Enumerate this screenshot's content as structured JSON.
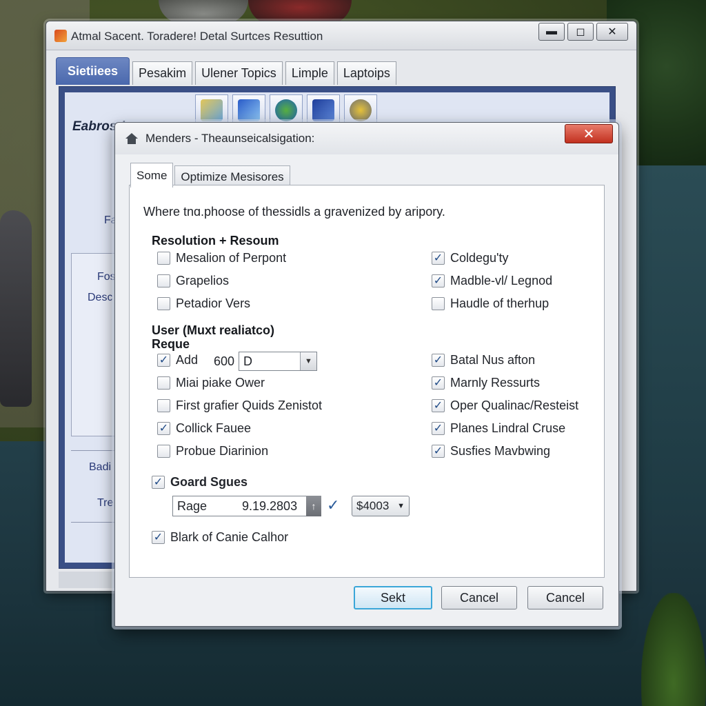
{
  "back_window": {
    "title": "Atmal Sacent. Toradere! Detal Surtces Resuttion",
    "tabs": [
      "Sietiiees",
      "Pesakim",
      "Ulener Topics",
      "Limple",
      "Laptoips"
    ],
    "labels": [
      "Eabrosd",
      "Fa",
      "Fos",
      "Desc",
      "Badi",
      "Tre"
    ],
    "toolbar_icons": [
      "image-icon",
      "tools-icon",
      "globe-icon",
      "cursor-icon",
      "gear-icon"
    ]
  },
  "dialog": {
    "title": "Menders - Theaunseicalsigation:",
    "tabs": [
      "Some",
      "Optimize Mesisores"
    ],
    "description": "Where tnɑ.phoose of thessidls a gravenized by aripory.",
    "section1": {
      "heading": "Resolution + Resoum",
      "left": [
        {
          "label": "Mesalion of Perpont",
          "checked": false
        },
        {
          "label": "Grapelios",
          "checked": false
        },
        {
          "label": "Petadior Vers",
          "checked": false
        }
      ],
      "right": [
        {
          "label": "Coldegu'ty",
          "checked": true
        },
        {
          "label": "Madble‑vl/ Legnod",
          "checked": true
        },
        {
          "label": "Haudle of therhup",
          "checked": false
        }
      ]
    },
    "section2": {
      "heading_line1": "User (Muxt realiatco)",
      "heading_line2": "Reque",
      "add_label": "Add",
      "add_checked": true,
      "add_value": "600",
      "add_select": "D",
      "left": [
        {
          "label": "Miai piake Ower",
          "checked": false
        },
        {
          "label": "First grafier Quids Zenistot",
          "checked": false
        },
        {
          "label": "Collick Fauee",
          "checked": true
        },
        {
          "label": "Probue Diarinion",
          "checked": false
        }
      ],
      "right": [
        {
          "label": "Batal Nus afton",
          "checked": true
        },
        {
          "label": "Marnly Ressurts",
          "checked": true
        },
        {
          "label": "Oper Qualinac/Resteist",
          "checked": true
        },
        {
          "label": "Planes Lindral Cruse",
          "checked": true
        },
        {
          "label": "Susfies Mavbwing",
          "checked": true
        }
      ]
    },
    "guard": {
      "label": "Goard Sgues",
      "checked": true,
      "range_label": "Rage",
      "range_value": "9.19.2803",
      "select_value": "$4003"
    },
    "bottom_check": {
      "label": "Blark of Canie Calhor",
      "checked": true
    },
    "buttons": {
      "ok": "Sekt",
      "cancel1": "Cancel",
      "cancel2": "Cancel"
    }
  }
}
